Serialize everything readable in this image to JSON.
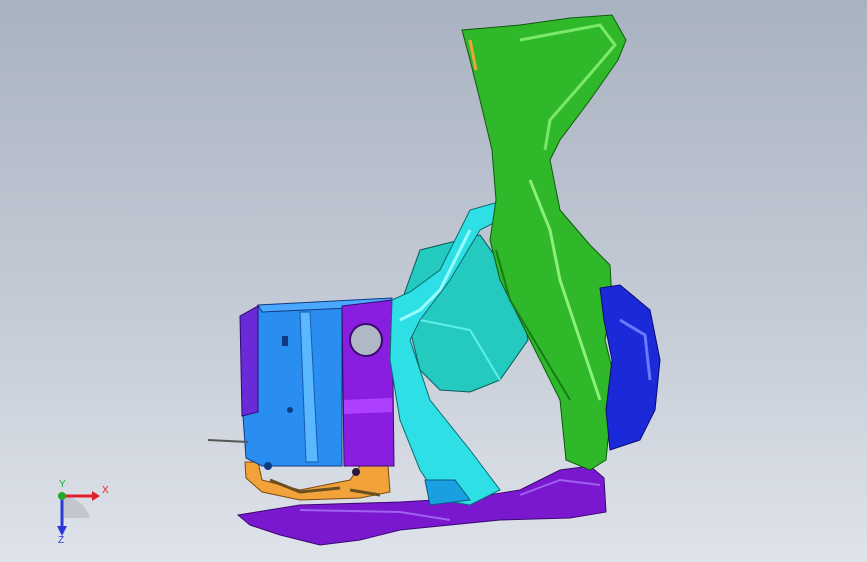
{
  "viewport": {
    "background_top": "#a9b2c1",
    "background_bottom": "#dfe3ea"
  },
  "model": {
    "parts": [
      {
        "name": "green-pillar-part",
        "color": "#2fb82a"
      },
      {
        "name": "cyan-bracket-part",
        "color": "#2ee0e6"
      },
      {
        "name": "teal-box-part",
        "color": "#24c9c0"
      },
      {
        "name": "blue-panel-part",
        "color": "#2a8ef0"
      },
      {
        "name": "purple-panel-part",
        "color": "#8a1ee0"
      },
      {
        "name": "dark-blue-cover-part",
        "color": "#1a2ad8"
      },
      {
        "name": "purple-floor-part",
        "color": "#7a18d0"
      },
      {
        "name": "orange-strip-part",
        "color": "#f2a23a"
      }
    ]
  },
  "triad": {
    "x_label": "X",
    "y_label": "Y",
    "z_label": "Z",
    "x_color": "#e0202a",
    "y_color": "#1faa2a",
    "z_color": "#2a3ad8"
  }
}
